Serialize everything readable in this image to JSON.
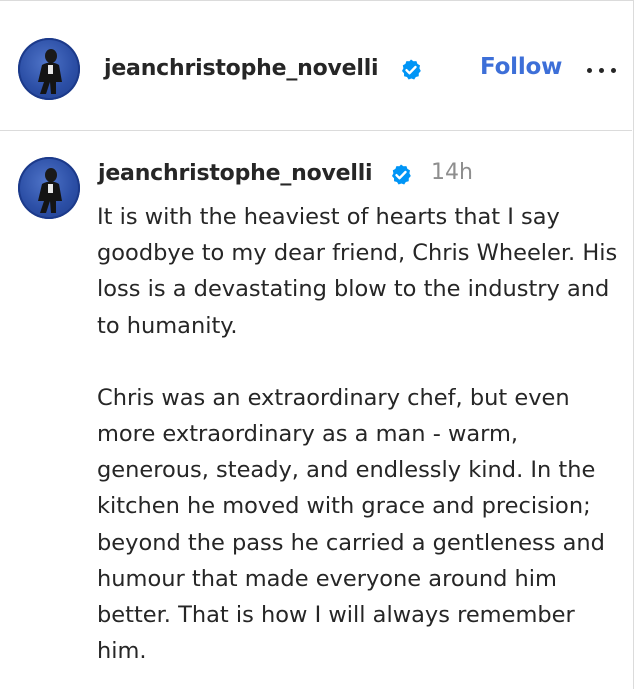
{
  "post": {
    "header": {
      "username": "jeanchristophe_novelli",
      "verified_icon": "verified-badge-icon",
      "follow_label": "Follow",
      "more_icon": "more-options-icon"
    },
    "caption": {
      "username": "jeanchristophe_novelli",
      "timestamp": "14h",
      "paragraphs": [
        "It is with the heaviest of hearts that I say goodbye to my dear friend, Chris Wheeler. His loss is a devastating blow to the industry and to humanity.",
        "Chris was an extraordinary chef, but even more extraordinary as a man - warm, generous, steady, and endlessly kind. In the kitchen he moved with grace and precision; beyond the pass he carried a gentleness and humour that made everyone around him better. That is how I will always remember him."
      ]
    },
    "colors": {
      "follow": "#3d6fd8",
      "verified": "#0095f6",
      "timestamp": "#8e8e8e",
      "text": "#262626"
    }
  }
}
